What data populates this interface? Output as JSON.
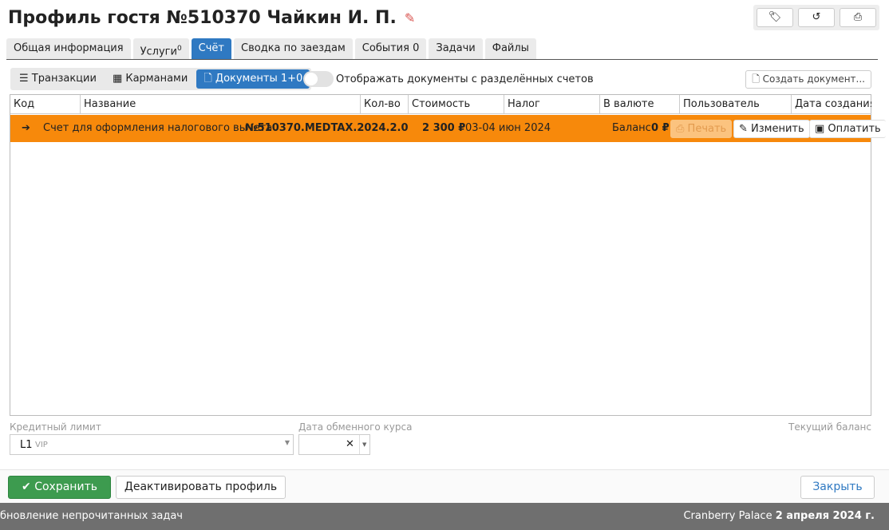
{
  "header": {
    "title": "Профиль гостя №510370 Чайкин И. П.",
    "buttons": [
      "tags-icon",
      "history-icon",
      "print-icon"
    ]
  },
  "tabs": [
    {
      "label": "Общая информация"
    },
    {
      "label": "Услуги",
      "badge": "0"
    },
    {
      "label": "Счёт"
    },
    {
      "label": "Сводка по заездам"
    },
    {
      "label": "События 0"
    },
    {
      "label": "Задачи"
    },
    {
      "label": "Файлы"
    }
  ],
  "subtabs": [
    {
      "label": "Транзакции"
    },
    {
      "label": "Карманами"
    },
    {
      "label": "Документы 1+0"
    }
  ],
  "toggle_label": "Отображать документы с разделённых счетов",
  "create_doc": "Создать документ...",
  "columns": [
    "Код",
    "Название",
    "Кол-во",
    "Стоимость",
    "Налог",
    "В валюте",
    "Пользователь",
    "Дата создания"
  ],
  "row": {
    "name": "Счет для оформления налогового вычета",
    "number": "№510370.MEDTAX.2024.2.0",
    "amount": "2 300 ₽",
    "dates": "03-04 июн 2024",
    "balance_label": "Баланс",
    "balance": "0 ₽",
    "print": "Печать",
    "edit": "Изменить",
    "pay": "Оплатить"
  },
  "credit": {
    "label": "Кредитный лимит",
    "value": "L1",
    "sub": "VIP"
  },
  "rate_date": {
    "label": "Дата обменного курса",
    "value": ""
  },
  "current_balance": "Текущий баланс",
  "footer": {
    "save": "Сохранить",
    "deactivate": "Деактивировать профиль",
    "close": "Закрыть"
  },
  "status": {
    "left": "бновление непрочитанных задач",
    "hotel": "Cranberry Palace",
    "date": "2 апреля 2024 г."
  },
  "colors": {
    "accent": "#2f79c2",
    "row": "#f7890b",
    "save": "#3d9b4f"
  }
}
